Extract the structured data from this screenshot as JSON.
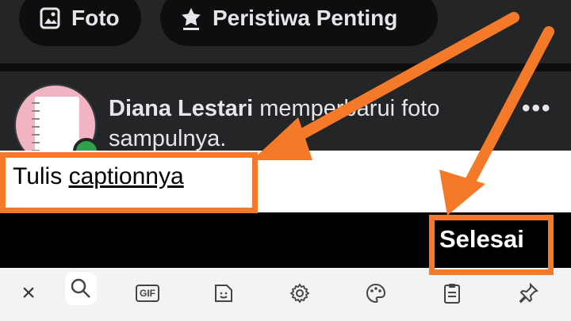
{
  "tabs": [
    {
      "label": "Foto",
      "icon": "photo-icon"
    },
    {
      "label": "Peristiwa Penting",
      "icon": "life-event-icon"
    }
  ],
  "post": {
    "author": "Diana Lestari",
    "action": " memperbarui foto sampulnya.",
    "more": "•••"
  },
  "caption": {
    "prefix": "Tulis ",
    "linked": "captionnya"
  },
  "done_label": "Selesai",
  "keyboard": {
    "items": [
      "close-icon",
      "search-icon",
      "gif-icon",
      "sticker-icon",
      "settings-icon",
      "theme-palette-icon",
      "clipboard-icon",
      "pin-icon"
    ],
    "gif_label": "GIF",
    "close_label": "×"
  },
  "colors": {
    "annotation": "#f47a2a",
    "status_online": "#31a24c",
    "background": "#242526"
  }
}
